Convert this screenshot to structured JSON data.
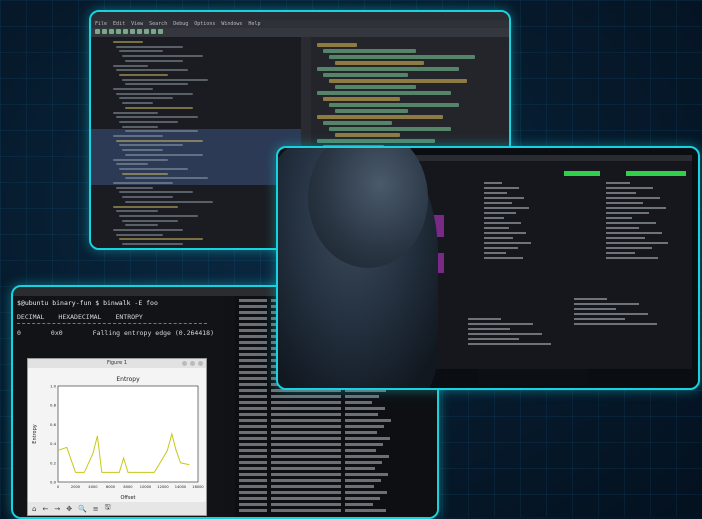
{
  "panel_a": {
    "title": "",
    "menu": [
      "File",
      "Edit",
      "View",
      "Search",
      "Debug",
      "Options",
      "Windows",
      "Help"
    ]
  },
  "panel_c": {
    "window_title": "",
    "terminal": {
      "prompt": "$@ubuntu binary-fun $ binwalk -E foo",
      "headers": [
        "DECIMAL",
        "HEXADECIMAL",
        "ENTROPY"
      ],
      "row": {
        "decimal": "0",
        "hex": "0x0",
        "entropy": "Falling entropy edge (0.264418)"
      }
    },
    "figure": {
      "window_title": "Figure 1",
      "toolbar_glyphs": [
        "⌂",
        "←",
        "→",
        "✥",
        "🔍",
        "≡",
        "🖫"
      ]
    }
  },
  "colors": {
    "frame": "#19d2e0",
    "plot_line": "#c8c81a",
    "highlight_purple": "#7a2a86",
    "status_green": "#2fd04a"
  },
  "chart_data": {
    "type": "line",
    "title": "Entropy",
    "xlabel": "Offset",
    "ylabel": "Entropy",
    "xlim": [
      0,
      16000
    ],
    "ylim": [
      0,
      1.0
    ],
    "x_ticks": [
      "0",
      "2000",
      "4000",
      "6000",
      "8000",
      "10000",
      "12000",
      "14000",
      "16000"
    ],
    "y_ticks": [
      "0.0",
      "0.2",
      "0.4",
      "0.6",
      "0.8",
      "1.0"
    ],
    "series": [
      {
        "color": "#c8c81a",
        "x": [
          0,
          1000,
          2000,
          3000,
          4000,
          4500,
          5000,
          6000,
          7000,
          7500,
          8000,
          9000,
          10000,
          11000,
          12000,
          12500,
          13000,
          13500,
          14000,
          15000
        ],
        "y": [
          0.33,
          0.36,
          0.1,
          0.1,
          0.3,
          0.48,
          0.1,
          0.1,
          0.1,
          0.25,
          0.1,
          0.1,
          0.1,
          0.1,
          0.25,
          0.33,
          0.5,
          0.33,
          0.2,
          0.18
        ]
      }
    ]
  }
}
